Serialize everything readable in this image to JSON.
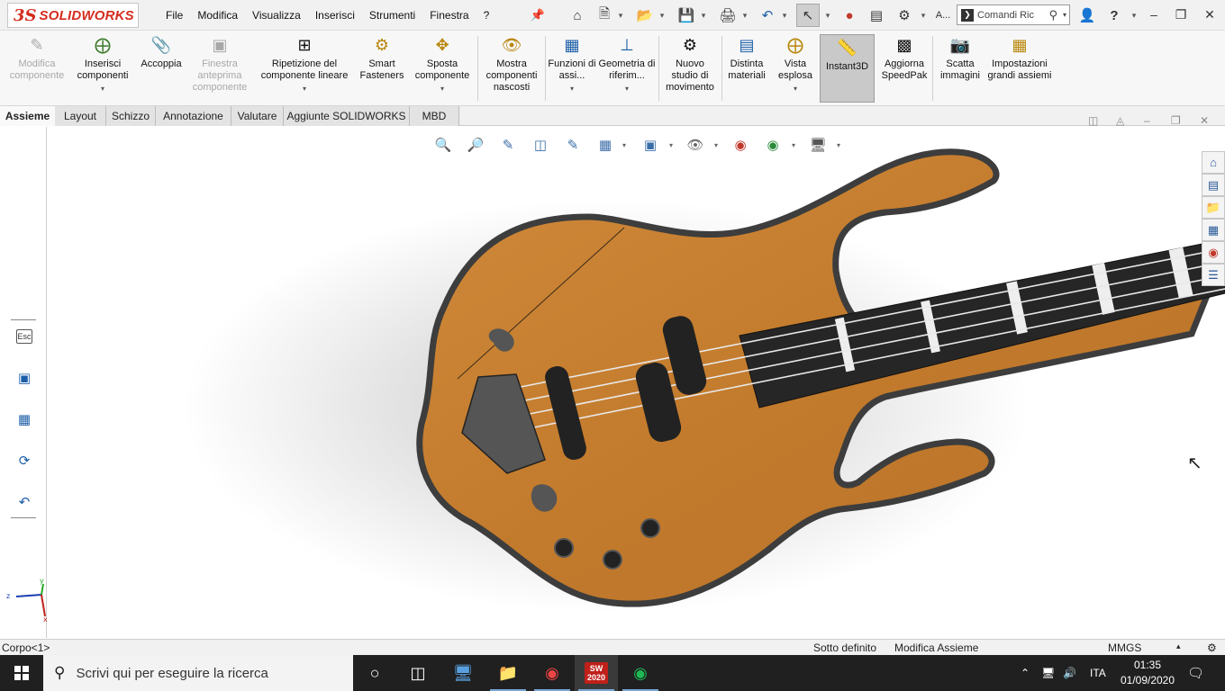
{
  "app": {
    "logo_ds": "3S",
    "logo_name": "SOLIDWORKS"
  },
  "menu": [
    "File",
    "Modifica",
    "Visualizza",
    "Inserisci",
    "Strumenti",
    "Finestra",
    "?"
  ],
  "toolbar_truncated_label": "A...",
  "command_search": {
    "value": "Comandi Ric"
  },
  "window_controls": [
    "minimize",
    "restore",
    "close"
  ],
  "commands": [
    {
      "label": "Modifica componente",
      "icon": "edit-component-icon",
      "enabled": false
    },
    {
      "label": "Inserisci componenti",
      "icon": "insert-components-icon",
      "enabled": true,
      "dropdown": true
    },
    {
      "label": "Accoppia",
      "icon": "mate-paperclip-icon",
      "enabled": true
    },
    {
      "label": "Finestra anteprima componente",
      "icon": "preview-window-icon",
      "enabled": false
    },
    {
      "label": "Ripetizione del componente lineare",
      "icon": "linear-pattern-icon",
      "enabled": true,
      "dropdown": true
    },
    {
      "label": "Smart Fasteners",
      "icon": "smart-fasteners-icon",
      "enabled": true
    },
    {
      "label": "Sposta componente",
      "icon": "move-component-icon",
      "enabled": true,
      "dropdown": true
    },
    {
      "label": "Mostra componenti nascosti",
      "icon": "show-hidden-icon",
      "enabled": true
    },
    {
      "label": "Funzioni di assi...",
      "icon": "assembly-features-icon",
      "enabled": true,
      "dropdown": true
    },
    {
      "label": "Geometria di riferim...",
      "icon": "reference-geometry-icon",
      "enabled": true,
      "dropdown": true
    },
    {
      "label": "Nuovo studio di movimento",
      "icon": "motion-study-icon",
      "enabled": true
    },
    {
      "label": "Distinta materiali",
      "icon": "bill-of-materials-icon",
      "enabled": true
    },
    {
      "label": "Vista esplosa",
      "icon": "exploded-view-icon",
      "enabled": true,
      "dropdown": true
    },
    {
      "label": "Instant3D",
      "icon": "instant3d-icon",
      "enabled": true,
      "active": true
    },
    {
      "label": "Aggiorna SpeedPak",
      "icon": "speedpak-icon",
      "enabled": true
    },
    {
      "label": "Scatta immagini",
      "icon": "camera-icon",
      "enabled": true
    },
    {
      "label": "Impostazioni grandi assiemi",
      "icon": "large-assembly-icon",
      "enabled": true
    }
  ],
  "tabs": [
    "Assieme",
    "Layout",
    "Schizzo",
    "Annotazione",
    "Valutare",
    "Aggiunte SOLIDWORKS",
    "MBD"
  ],
  "active_tab": "Assieme",
  "left_panel": {
    "esc_label": "Esc",
    "icons": [
      "esc-icon",
      "view-orientation-icon",
      "select-other-icon",
      "rotate-lock-icon",
      "undo-icon"
    ]
  },
  "heads_up": [
    "zoom-to-fit-icon",
    "zoom-area-icon",
    "previous-view-icon",
    "section-view-icon",
    "dynamic-annotation-icon",
    "view-orientation-icon",
    "display-style-icon",
    "hide-show-icon",
    "edit-appearance-icon",
    "apply-scene-icon",
    "view-settings-icon"
  ],
  "task_pane": [
    "home-icon",
    "design-library-icon",
    "file-explorer-icon",
    "view-palette-icon",
    "appearances-icon",
    "custom-properties-icon"
  ],
  "triad": {
    "x": "x",
    "y": "y",
    "z": "z"
  },
  "model": {
    "name": "electric bass guitar assembly",
    "body_color": "#c7822f",
    "binding_color": "#4a4a4a",
    "fretboard_color": "#2a2a2a"
  },
  "status": {
    "left": "Corpo<1>",
    "definition": "Sotto definito",
    "mode": "Modifica Assieme",
    "units": "MMGS"
  },
  "taskbar": {
    "search_placeholder": "Scrivi qui per eseguire la ricerca",
    "apps": [
      "cortana-icon",
      "task-view-icon",
      "network-app-icon",
      "file-explorer-icon",
      "chrome-icon",
      "solidworks-2020-icon",
      "spotify-icon"
    ],
    "solidworks_badge": "2020",
    "language": "ITA",
    "time": "01:35",
    "date": "01/09/2020"
  },
  "colors": {
    "brand_red": "#d52b1e",
    "accent_blue": "#1c5fa8",
    "taskbar": "#202020"
  }
}
